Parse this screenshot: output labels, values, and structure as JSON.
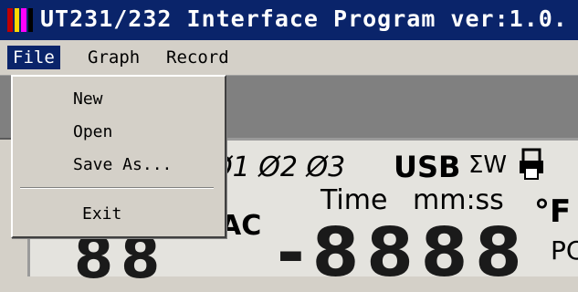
{
  "window": {
    "title": "UT231/232 Interface Program ver:1.0."
  },
  "menubar": {
    "items": [
      {
        "label": "File"
      },
      {
        "label": "Graph"
      },
      {
        "label": "Record"
      }
    ]
  },
  "file_menu": {
    "items": [
      {
        "label": "New"
      },
      {
        "label": "Open"
      },
      {
        "label": "Save As..."
      },
      {
        "label": "Exit"
      }
    ]
  },
  "lcd": {
    "indicators": "Ø1 Ø2 Ø3",
    "usb": "USB",
    "sigma": "ΣW",
    "ac": "AC",
    "time_label": "Time",
    "time_unit": "mm:ss",
    "temp_unit": "°F",
    "pf_partial": "PC",
    "left_digits": "88",
    "main_digits": "-8888"
  },
  "colors": {
    "titlebar": "#0a246a",
    "menu_highlight": "#0a246a",
    "menu_bg": "#d4d0c8",
    "toolbar_bg": "#808080",
    "lcd_bg": "#e4e3de"
  }
}
